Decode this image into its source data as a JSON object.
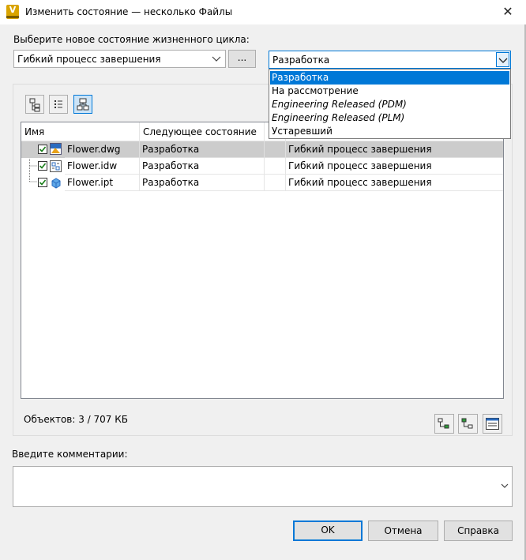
{
  "window": {
    "title": "Изменить состояние — несколько Файлы",
    "close_glyph": "✕",
    "app_icon_letter": "V"
  },
  "lifecycle": {
    "label": "Выберите новое состояние жизненного цикла:",
    "process_value": "Гибкий процесс завершения",
    "browse_label": "...",
    "state_value": "Разработка",
    "options": [
      {
        "label": "Разработка",
        "selected": true,
        "italic": false
      },
      {
        "label": "На рассмотрение",
        "selected": false,
        "italic": false
      },
      {
        "label": "Engineering Released (PDM)",
        "selected": false,
        "italic": true
      },
      {
        "label": "Engineering Released (PLM)",
        "selected": false,
        "italic": true
      },
      {
        "label": "Устаревший",
        "selected": false,
        "italic": false
      }
    ]
  },
  "toolbar": {
    "buttons": [
      {
        "icon": "tree-view-icon",
        "active": false
      },
      {
        "icon": "list-view-icon",
        "active": false
      },
      {
        "icon": "hierarchy-view-icon",
        "active": true
      }
    ]
  },
  "grid": {
    "columns": [
      "Имя",
      "Следующее состояние",
      "",
      ""
    ],
    "rows": [
      {
        "name": "Flower.dwg",
        "next_state": "Разработка",
        "col3": "",
        "process": "Гибкий процесс завершения",
        "checked": true,
        "icon": "dwg-file-icon",
        "selected": true
      },
      {
        "name": "Flower.idw",
        "next_state": "Разработка",
        "col3": "",
        "process": "Гибкий процесс завершения",
        "checked": true,
        "icon": "idw-file-icon",
        "selected": false
      },
      {
        "name": "Flower.ipt",
        "next_state": "Разработка",
        "col3": "",
        "process": "Гибкий процесс завершения",
        "checked": true,
        "icon": "ipt-file-icon",
        "selected": false
      }
    ]
  },
  "status": {
    "objects": "Объектов: 3 / 707 КБ"
  },
  "bottom_icons": [
    "expand-tree-icon",
    "collapse-tree-icon",
    "details-panel-icon"
  ],
  "comment": {
    "label": "Введите комментарии:",
    "value": ""
  },
  "buttons": {
    "ok": "OK",
    "cancel": "Отмена",
    "help": "Справка"
  },
  "colors": {
    "accent": "#0078d7",
    "app_icon": "#d9a400",
    "selected_row": "#cccccc"
  }
}
